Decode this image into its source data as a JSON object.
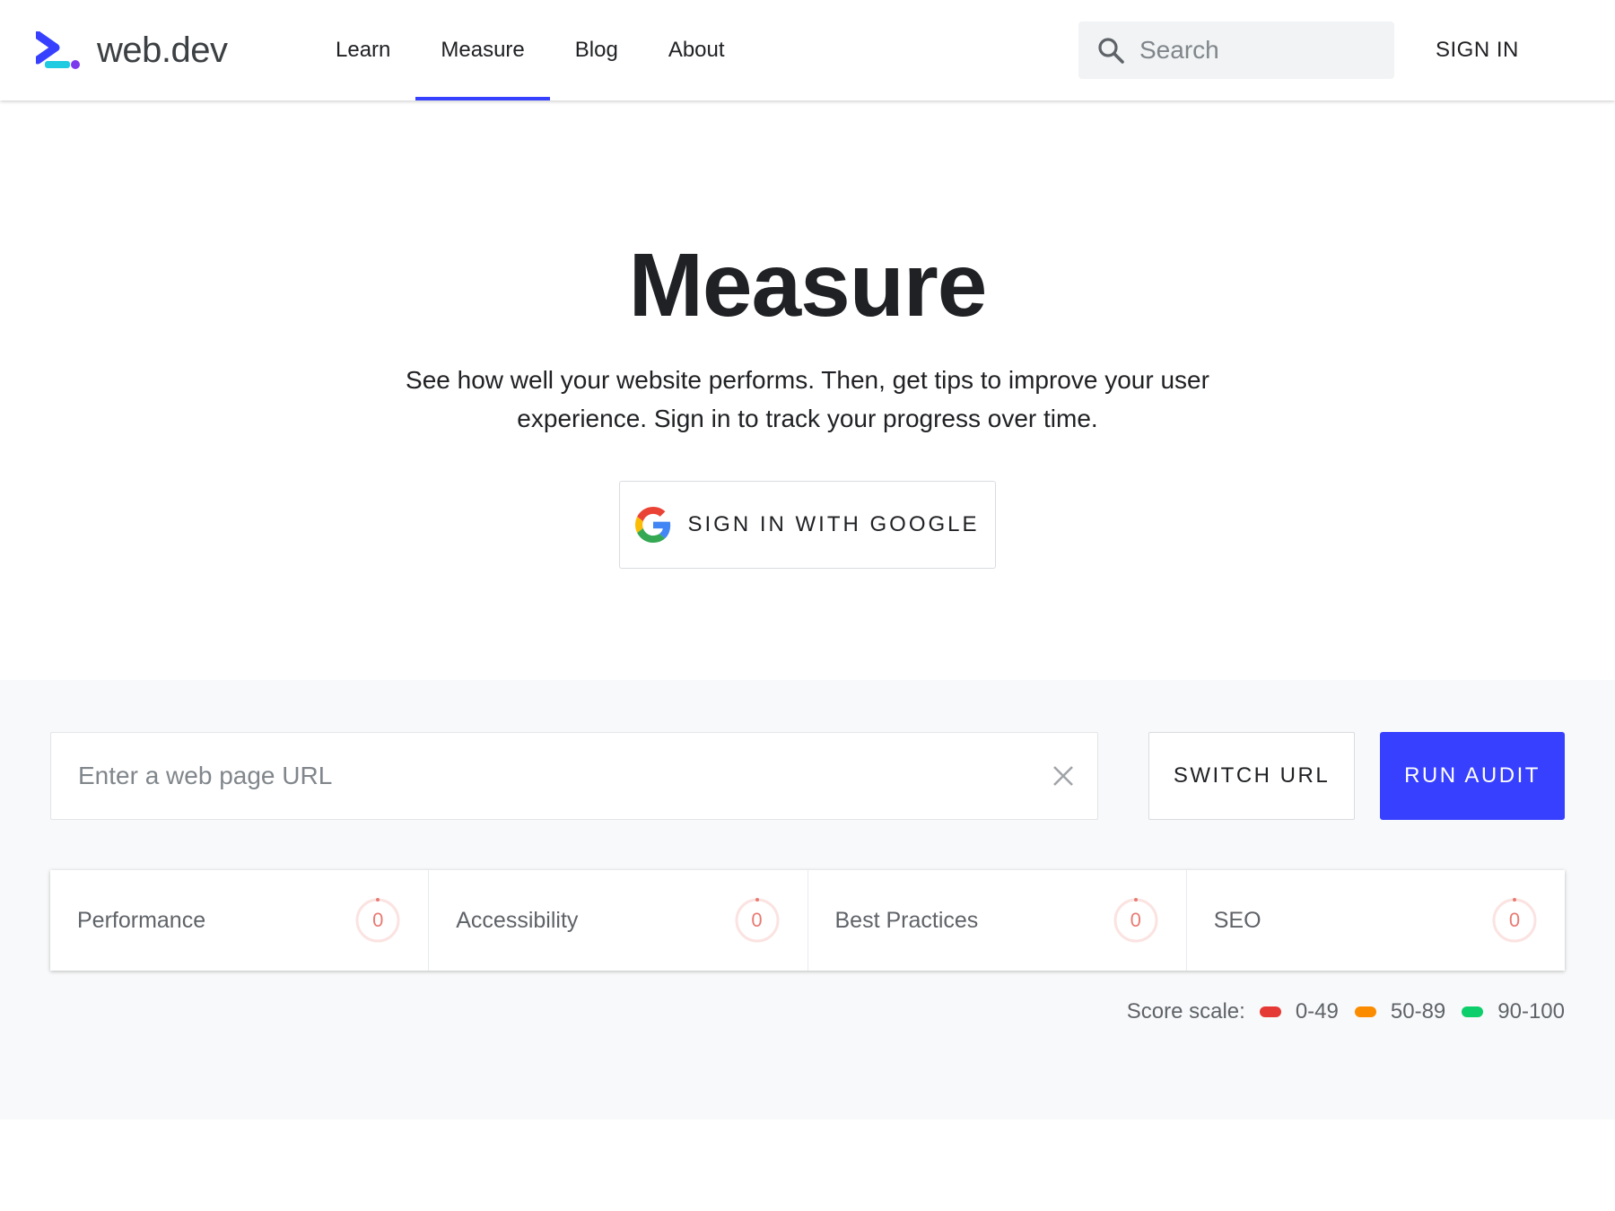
{
  "header": {
    "logo_text": "web.dev",
    "nav": [
      "Learn",
      "Measure",
      "Blog",
      "About"
    ],
    "active_nav": "Measure",
    "search_placeholder": "Search",
    "sign_in": "SIGN IN"
  },
  "hero": {
    "title": "Measure",
    "description": "See how well your website performs. Then, get tips to improve your user experience. Sign in to track your progress over time.",
    "google_button": "SIGN IN WITH GOOGLE"
  },
  "audit": {
    "url_placeholder": "Enter a web page URL",
    "url_value": "",
    "switch_url": "SWITCH URL",
    "run_audit": "RUN AUDIT",
    "scores": [
      {
        "name": "Performance",
        "value": "0"
      },
      {
        "name": "Accessibility",
        "value": "0"
      },
      {
        "name": "Best Practices",
        "value": "0"
      },
      {
        "name": "SEO",
        "value": "0"
      }
    ],
    "scale_label": "Score scale:",
    "scale": [
      {
        "range": "0-49",
        "color": "#e53935"
      },
      {
        "range": "50-89",
        "color": "#fb8c00"
      },
      {
        "range": "90-100",
        "color": "#0cce6b"
      }
    ]
  },
  "colors": {
    "accent": "#3740ff",
    "score_zero": "#e87b73"
  }
}
